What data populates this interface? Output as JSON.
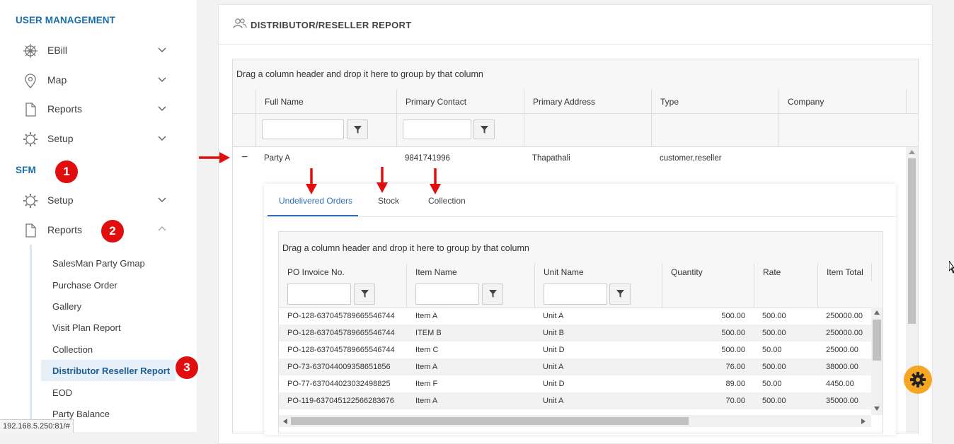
{
  "sidebar": {
    "user_management_title": "USER MANAGEMENT",
    "user_items": [
      {
        "label": "EBill",
        "icon": "wheel-icon"
      },
      {
        "label": "Map",
        "icon": "map-pin-icon"
      },
      {
        "label": "Reports",
        "icon": "document-icon"
      },
      {
        "label": "Setup",
        "icon": "gear-icon"
      }
    ],
    "sfm_title": "SFM",
    "sfm_items": [
      {
        "label": "Setup",
        "icon": "gear-icon"
      },
      {
        "label": "Reports",
        "icon": "document-icon"
      }
    ],
    "report_sub_items": [
      "SalesMan Party Gmap",
      "Purchase Order",
      "Gallery",
      "Visit Plan Report",
      "Collection",
      "Distributor Reseller Report",
      "EOD",
      "Party Balance"
    ],
    "active_sub_item": "Distributor Reseller Report",
    "url": "192.168.5.250:81/#"
  },
  "annotations": [
    "1",
    "2",
    "3"
  ],
  "panel": {
    "title": "DISTRIBUTOR/RESELLER REPORT"
  },
  "grid": {
    "group_hint": "Drag a column header and drop it here to group by that column",
    "columns": [
      "Full Name",
      "Primary Contact",
      "Primary Address",
      "Type",
      "Company"
    ],
    "rows": [
      {
        "full_name": "Party A",
        "primary_contact": "9841741996",
        "primary_address": "Thapathali",
        "type": "customer,reseller",
        "company": ""
      }
    ],
    "collapse_symbol": "−"
  },
  "detail": {
    "tabs": [
      "Undelivered Orders",
      "Stock",
      "Collection"
    ],
    "active_tab": "Undelivered Orders",
    "group_hint": "Drag a column header and drop it here to group by that column",
    "columns": [
      "PO Invoice No.",
      "Item Name",
      "Unit Name",
      "Quantity",
      "Rate",
      "Item Total"
    ],
    "rows": [
      [
        "PO-128-637045789665546744",
        "Item A",
        "Unit A",
        "500.00",
        "500.00",
        "250000.00"
      ],
      [
        "PO-128-637045789665546744",
        "ITEM B",
        "Unit B",
        "500.00",
        "500.00",
        "250000.00"
      ],
      [
        "PO-128-637045789665546744",
        "Item C",
        "Unit D",
        "500.00",
        "50.00",
        "25000.00"
      ],
      [
        "PO-73-637044009358651856",
        "Item A",
        "Unit A",
        "76.00",
        "500.00",
        "38000.00"
      ],
      [
        "PO-77-637044023032498825",
        "Item F",
        "Unit D",
        "89.00",
        "50.00",
        "4450.00"
      ],
      [
        "PO-119-637045122566283676",
        "Item A",
        "Unit A",
        "70.00",
        "500.00",
        "35000.00"
      ]
    ]
  },
  "colors": {
    "accent": "#1b6fa8",
    "tab_active": "#2f6fba",
    "badge": "#e00e0e",
    "gear_button": "#f5a623"
  }
}
